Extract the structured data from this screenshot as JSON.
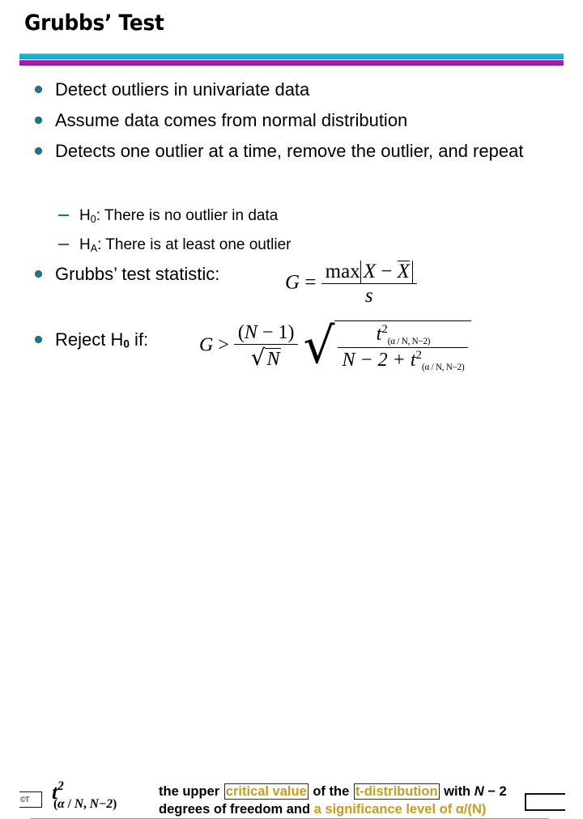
{
  "slide": {
    "title": "Grubbs’ Test",
    "divider_top_color": "#17b2ce",
    "divider_bottom_color": "#a21fb0",
    "bullet_color": "#21748f",
    "highlight_color": "#c79c22"
  },
  "bullets": [
    {
      "text": "Detect outliers in univariate data"
    },
    {
      "text": "Assume data comes from normal distribution"
    },
    {
      "text": "Detects one outlier at a time, remove the outlier, and repeat"
    }
  ],
  "sub_bullets": [
    {
      "symbol": "H",
      "subscript": "0",
      "text": ": There is no outlier in data"
    },
    {
      "symbol": "H",
      "subscript": "A",
      "text": ": There is at least one outlier"
    }
  ],
  "statistic": {
    "label": "Grubbs’ test statistic:",
    "formula": {
      "lhs": "G",
      "relation": "=",
      "numerator": "max|X − X̄|",
      "denominator": "s",
      "max_label": "max",
      "variable": "X",
      "mean_variable": "X",
      "minus": "−",
      "std_symbol": "s"
    }
  },
  "reject": {
    "label_before": "Reject H",
    "label_subscript": "0",
    "label_after": " if:",
    "formula": {
      "lhs": "G",
      "relation": ">",
      "coef_numerator": "(N − 1)",
      "coef_denominator": "√N",
      "coef_den_symbol": "N",
      "radicand_numerator_base": "t",
      "radicand_numerator_exponent": "2",
      "radicand_numerator_index": "(α / N, N−2)",
      "radicand_denominator": "N − 2 + t",
      "radicand_denominator_exponent": "2",
      "radicand_denominator_index": "(α / N, N−2)",
      "paren_open": "(",
      "paren_close": ")",
      "n_symbol": "N",
      "minus": "−",
      "one": "1",
      "two": "2",
      "plus": "+"
    }
  },
  "legend": {
    "symbol_base": "t",
    "symbol_exponent": "2",
    "symbol_index_prefix": "(",
    "symbol_index_alpha": "α",
    "symbol_index_slash": " / ",
    "symbol_index_n": "N",
    "symbol_index_comma": ", ",
    "symbol_index_df": "N−2",
    "symbol_index_suffix": ")",
    "line1_part1": "the upper ",
    "line1_highlight1": "critical value",
    "line1_part2": " of the ",
    "line1_highlight2": "t-distribution",
    "line1_part3": " with ",
    "line1_n": "N",
    "line1_part4": " − 2",
    "line2_part1": "degrees of freedom and ",
    "line2_gold": "a significance level of α/(N)",
    "watermark": "©T"
  }
}
